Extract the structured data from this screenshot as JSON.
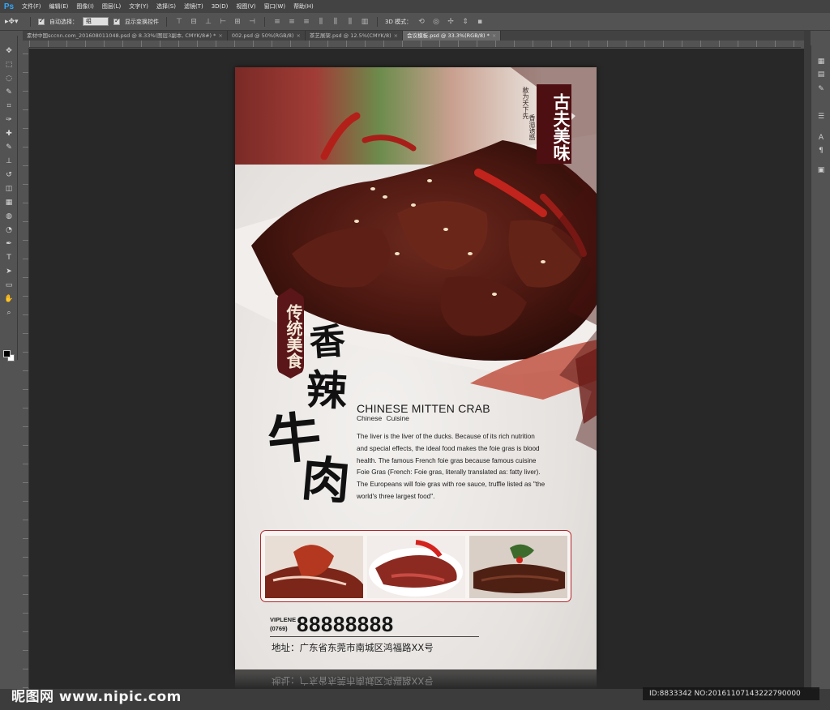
{
  "app": {
    "logo": "Ps",
    "menu": [
      "文件(F)",
      "编辑(E)",
      "图像(I)",
      "图层(L)",
      "文字(Y)",
      "选择(S)",
      "滤镜(T)",
      "3D(D)",
      "视图(V)",
      "窗口(W)",
      "帮助(H)"
    ]
  },
  "options_bar": {
    "auto_select_label": "自动选择：",
    "auto_select_value": "组",
    "show_transform_label": "显示变换控件",
    "mode_3d_label": "3D 模式："
  },
  "tabs": [
    {
      "label": "素材中国sccnn.com_201608011048.psd @ 8.33%(图层3副本, CMYK/8#) *",
      "active": false
    },
    {
      "label": "002.psd @ 50%(RGB/8)",
      "active": false
    },
    {
      "label": "茶艺展架.psd @ 12.5%(CMYK/8)",
      "active": false
    },
    {
      "label": "会议模板.psd @ 33.3%(RGB/8) *",
      "active": true
    }
  ],
  "tab_close": "×",
  "tools_left": [
    "move-icon",
    "marquee-icon",
    "lasso-icon",
    "quick-select-icon",
    "crop-icon",
    "eyedropper-icon",
    "healing-icon",
    "brush-icon",
    "stamp-icon",
    "history-brush-icon",
    "eraser-icon",
    "gradient-icon",
    "blur-icon",
    "dodge-icon",
    "pen-icon",
    "text-icon",
    "path-select-icon",
    "shape-icon",
    "hand-icon",
    "zoom-icon"
  ],
  "tool_glyphs": [
    "✥",
    "⬚",
    "◌",
    "✎",
    "⌗",
    "✑",
    "✚",
    "✎",
    "⊥",
    "↺",
    "◫",
    "▦",
    "◍",
    "◔",
    "✒",
    "T",
    "➤",
    "▭",
    "✋",
    "⌕"
  ],
  "tools_right": [
    "history-icon",
    "properties-icon",
    "brush-panel-icon",
    "adjust-icon",
    "character-icon",
    "paragraph-icon",
    "cube-icon"
  ],
  "tools_right_glyphs": [
    "▦",
    "▤",
    "✎",
    "☰",
    "A",
    "¶",
    "▣"
  ],
  "poster": {
    "seal_top": "古夫美味",
    "seal_side_1": "敢为天下先",
    "seal_side_2": "香溢诱惑",
    "badge": "传统美食",
    "calligraphy": [
      "香",
      "辣",
      "牛",
      "肉"
    ],
    "title_en": "CHINESE MITTEN CRAB",
    "subtitle_en": "Chinese Cuisine",
    "body": "The liver is the liver of the ducks. Because of its rich nutrition\nand special effects, the ideal food makes the foie gras is blood\nhealth. The famous French foie gras because famous cuisine\nFoie Gras (French: Foie gras, literally translated as: fatty liver).\nThe Europeans will foie gras with roe sauce, truffle listed as \"the\nworld's three largest food\".",
    "phone_label_top": "VIPLENE",
    "phone_label_bottom": "(0769)",
    "phone": "88888888",
    "address": "地址：广东省东莞市南城区鸿福路XX号",
    "colors": {
      "accent": "#5a1618",
      "frame": "#b3252b",
      "meat": "#5b1e16"
    }
  },
  "watermark": {
    "logo": "昵图网 www.nipic.com",
    "id_text": "ID:8833342 NO:20161107143222790000"
  }
}
